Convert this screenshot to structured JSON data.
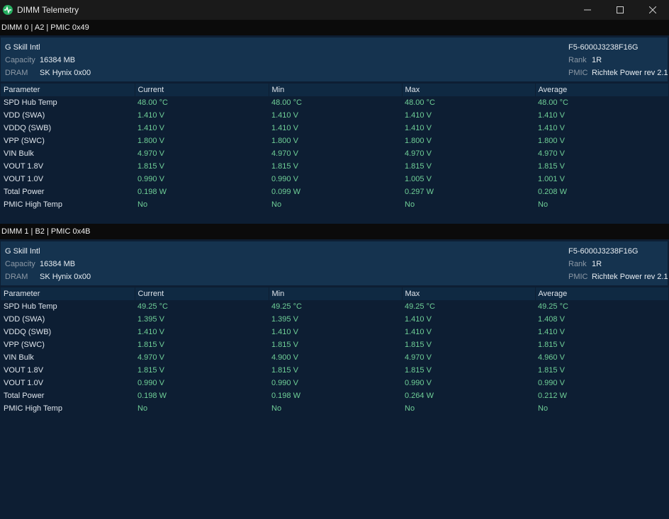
{
  "window": {
    "title": "DIMM Telemetry",
    "minimize_glyph": "—",
    "maximize_glyph": "☐",
    "close_glyph": "✕"
  },
  "columns": [
    "Parameter",
    "Current",
    "Min",
    "Max",
    "Average"
  ],
  "info_labels": {
    "capacity": "Capacity",
    "dram": "DRAM",
    "rank": "Rank",
    "pmic": "PMIC"
  },
  "dimms": [
    {
      "header": "DIMM 0 | A2 | PMIC 0x49",
      "vendor": "G Skill Intl",
      "capacity": "16384 MB",
      "dram": "SK Hynix 0x00",
      "part": "F5-6000J3238F16G",
      "rank": "1R",
      "pmic": "Richtek Power rev 2.1",
      "rows": [
        [
          "SPD Hub Temp",
          "48.00 °C",
          "48.00 °C",
          "48.00 °C",
          "48.00 °C"
        ],
        [
          "VDD (SWA)",
          "1.410 V",
          "1.410 V",
          "1.410 V",
          "1.410 V"
        ],
        [
          "VDDQ (SWB)",
          "1.410 V",
          "1.410 V",
          "1.410 V",
          "1.410 V"
        ],
        [
          "VPP (SWC)",
          "1.800 V",
          "1.800 V",
          "1.800 V",
          "1.800 V"
        ],
        [
          "VIN Bulk",
          "4.970 V",
          "4.970 V",
          "4.970 V",
          "4.970 V"
        ],
        [
          "VOUT 1.8V",
          "1.815 V",
          "1.815 V",
          "1.815 V",
          "1.815 V"
        ],
        [
          "VOUT 1.0V",
          "0.990 V",
          "0.990 V",
          "1.005 V",
          "1.001 V"
        ],
        [
          "Total Power",
          "0.198 W",
          "0.099 W",
          "0.297 W",
          "0.208 W"
        ],
        [
          "PMIC High Temp",
          "No",
          "No",
          "No",
          "No"
        ]
      ]
    },
    {
      "header": "DIMM 1 | B2 | PMIC 0x4B",
      "vendor": "G Skill Intl",
      "capacity": "16384 MB",
      "dram": "SK Hynix 0x00",
      "part": "F5-6000J3238F16G",
      "rank": "1R",
      "pmic": "Richtek Power rev 2.1",
      "rows": [
        [
          "SPD Hub Temp",
          "49.25 °C",
          "49.25 °C",
          "49.25 °C",
          "49.25 °C"
        ],
        [
          "VDD (SWA)",
          "1.395 V",
          "1.395 V",
          "1.410 V",
          "1.408 V"
        ],
        [
          "VDDQ (SWB)",
          "1.410 V",
          "1.410 V",
          "1.410 V",
          "1.410 V"
        ],
        [
          "VPP (SWC)",
          "1.815 V",
          "1.815 V",
          "1.815 V",
          "1.815 V"
        ],
        [
          "VIN Bulk",
          "4.970 V",
          "4.900 V",
          "4.970 V",
          "4.960 V"
        ],
        [
          "VOUT 1.8V",
          "1.815 V",
          "1.815 V",
          "1.815 V",
          "1.815 V"
        ],
        [
          "VOUT 1.0V",
          "0.990 V",
          "0.990 V",
          "0.990 V",
          "0.990 V"
        ],
        [
          "Total Power",
          "0.198 W",
          "0.198 W",
          "0.264 W",
          "0.212 W"
        ],
        [
          "PMIC High Temp",
          "No",
          "No",
          "No",
          "No"
        ]
      ]
    }
  ]
}
